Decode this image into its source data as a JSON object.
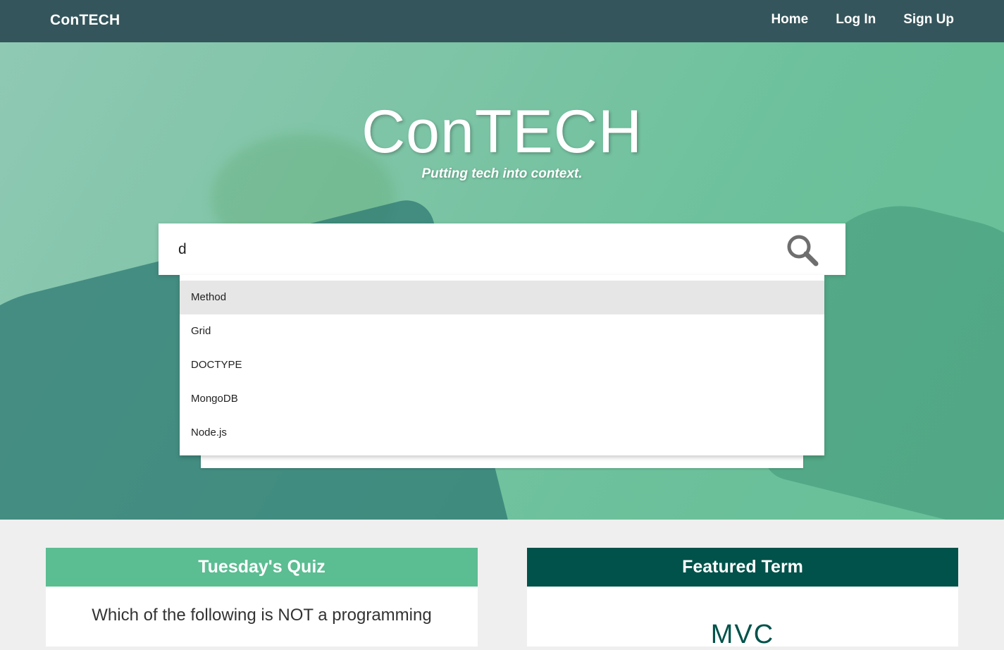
{
  "navbar": {
    "brand": "ConTECH",
    "links": [
      "Home",
      "Log In",
      "Sign Up"
    ]
  },
  "hero": {
    "title": "ConTECH",
    "subtitle": "Putting tech into context."
  },
  "search": {
    "value": "d",
    "icon": "search-icon",
    "suggestions": [
      "Method",
      "Grid",
      "DOCTYPE",
      "MongoDB",
      "Node.js"
    ],
    "highlighted_index": 0
  },
  "quiz_card": {
    "header": "Tuesday's Quiz",
    "question": "Which of the following is NOT a programming"
  },
  "featured_card": {
    "header": "Featured Term",
    "term": "MVC"
  },
  "colors": {
    "navbar": "#34555b",
    "quiz_header": "#5bbd92",
    "featured_header": "#00524a",
    "page_background": "#efefef"
  }
}
